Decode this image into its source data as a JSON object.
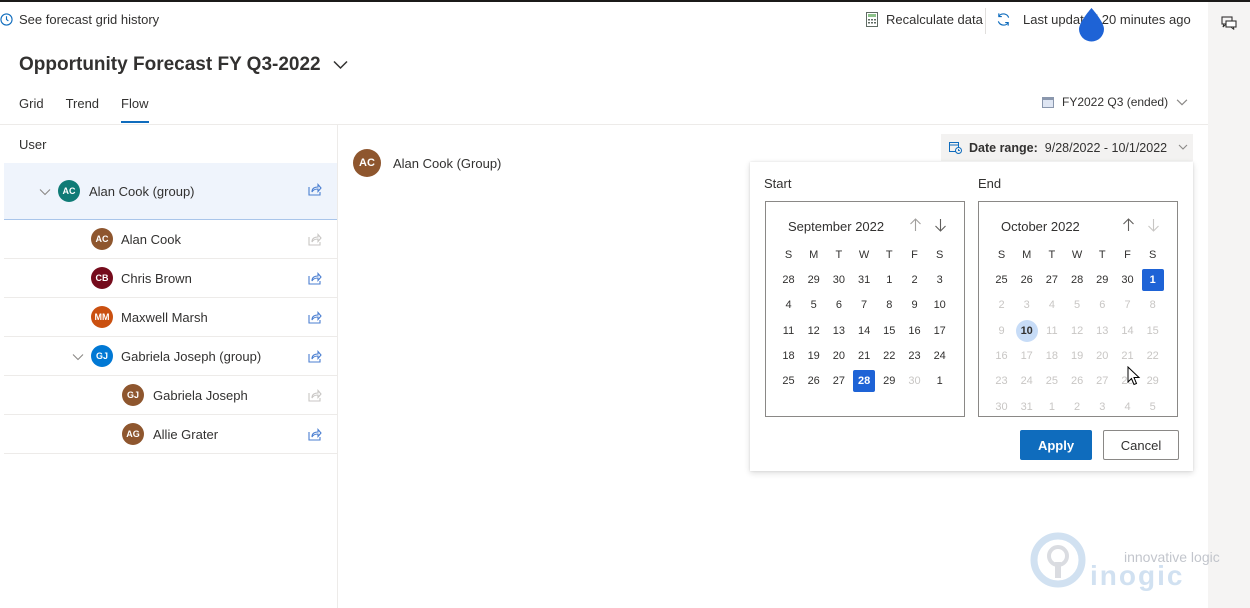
{
  "colors": {
    "accent": "#0f6cbd",
    "selected_day": "#1e63d6",
    "today_highlight": "#c7dcf7",
    "group_row_bg": "#eff4fc"
  },
  "commandbar": {
    "history_label": "See forecast grid history",
    "recalculate_label": "Recalculate data",
    "last_updated_label": "Last updated 20 minutes ago",
    "icons": {
      "history": "clock-history-icon",
      "recalculate": "calculator-icon",
      "refresh": "refresh-icon",
      "chat": "chat-icon"
    }
  },
  "header": {
    "title": "Opportunity Forecast FY Q3-2022",
    "period_label": "FY2022 Q3 (ended)"
  },
  "tabs": [
    {
      "label": "Grid",
      "active": false
    },
    {
      "label": "Trend",
      "active": false
    },
    {
      "label": "Flow",
      "active": true
    }
  ],
  "tree": {
    "column_header": "User",
    "rows": [
      {
        "initials": "AC",
        "name": "Alan Cook (group)",
        "color": "#0f7b76",
        "level": 0,
        "expandable": true,
        "share_enabled": true
      },
      {
        "initials": "AC",
        "name": "Alan Cook",
        "color": "#8e562e",
        "level": 1,
        "expandable": false,
        "share_enabled": false
      },
      {
        "initials": "CB",
        "name": "Chris Brown",
        "color": "#750b1c",
        "level": 1,
        "expandable": false,
        "share_enabled": true
      },
      {
        "initials": "MM",
        "name": "Maxwell Marsh",
        "color": "#ca5010",
        "level": 1,
        "expandable": false,
        "share_enabled": true
      },
      {
        "initials": "GJ",
        "name": "Gabriela Joseph (group)",
        "color": "#0078d4",
        "level": 1,
        "expandable": true,
        "share_enabled": true
      },
      {
        "initials": "GJ",
        "name": "Gabriela Joseph",
        "color": "#8e562e",
        "level": 2,
        "expandable": false,
        "share_enabled": false
      },
      {
        "initials": "AG",
        "name": "Allie Grater",
        "color": "#8e562e",
        "level": 2,
        "expandable": false,
        "share_enabled": true
      }
    ]
  },
  "main": {
    "selected_user": {
      "initials": "AC",
      "name": "Alan Cook (Group)",
      "color": "#8e562e"
    }
  },
  "date_range": {
    "label": "Date range:",
    "value": "9/28/2022 - 10/1/2022",
    "start": {
      "label": "Start",
      "month": "September 2022",
      "weekdays": [
        "S",
        "M",
        "T",
        "W",
        "T",
        "F",
        "S"
      ],
      "weeks": [
        [
          "28",
          "29",
          "30",
          "31",
          "1",
          "2",
          "3"
        ],
        [
          "4",
          "5",
          "6",
          "7",
          "8",
          "9",
          "10"
        ],
        [
          "11",
          "12",
          "13",
          "14",
          "15",
          "16",
          "17"
        ],
        [
          "18",
          "19",
          "20",
          "21",
          "22",
          "23",
          "24"
        ],
        [
          "25",
          "26",
          "27",
          "28",
          "29",
          "30",
          "1"
        ]
      ],
      "selected": [
        4,
        3
      ],
      "disabled": [
        [
          4,
          5
        ]
      ],
      "today": null
    },
    "end": {
      "label": "End",
      "month": "October 2022",
      "weekdays": [
        "S",
        "M",
        "T",
        "W",
        "T",
        "F",
        "S"
      ],
      "weeks": [
        [
          "25",
          "26",
          "27",
          "28",
          "29",
          "30",
          "1"
        ],
        [
          "2",
          "3",
          "4",
          "5",
          "6",
          "7",
          "8"
        ],
        [
          "9",
          "10",
          "11",
          "12",
          "13",
          "14",
          "15"
        ],
        [
          "16",
          "17",
          "18",
          "19",
          "20",
          "21",
          "22"
        ],
        [
          "23",
          "24",
          "25",
          "26",
          "27",
          "28",
          "29"
        ],
        [
          "30",
          "31",
          "1",
          "2",
          "3",
          "4",
          "5"
        ]
      ],
      "selected": [
        0,
        6
      ],
      "disabled_from_week": 1,
      "today": [
        2,
        1
      ]
    },
    "apply_label": "Apply",
    "cancel_label": "Cancel"
  },
  "watermark": {
    "tagline": "innovative logic",
    "brand": "inogic"
  }
}
